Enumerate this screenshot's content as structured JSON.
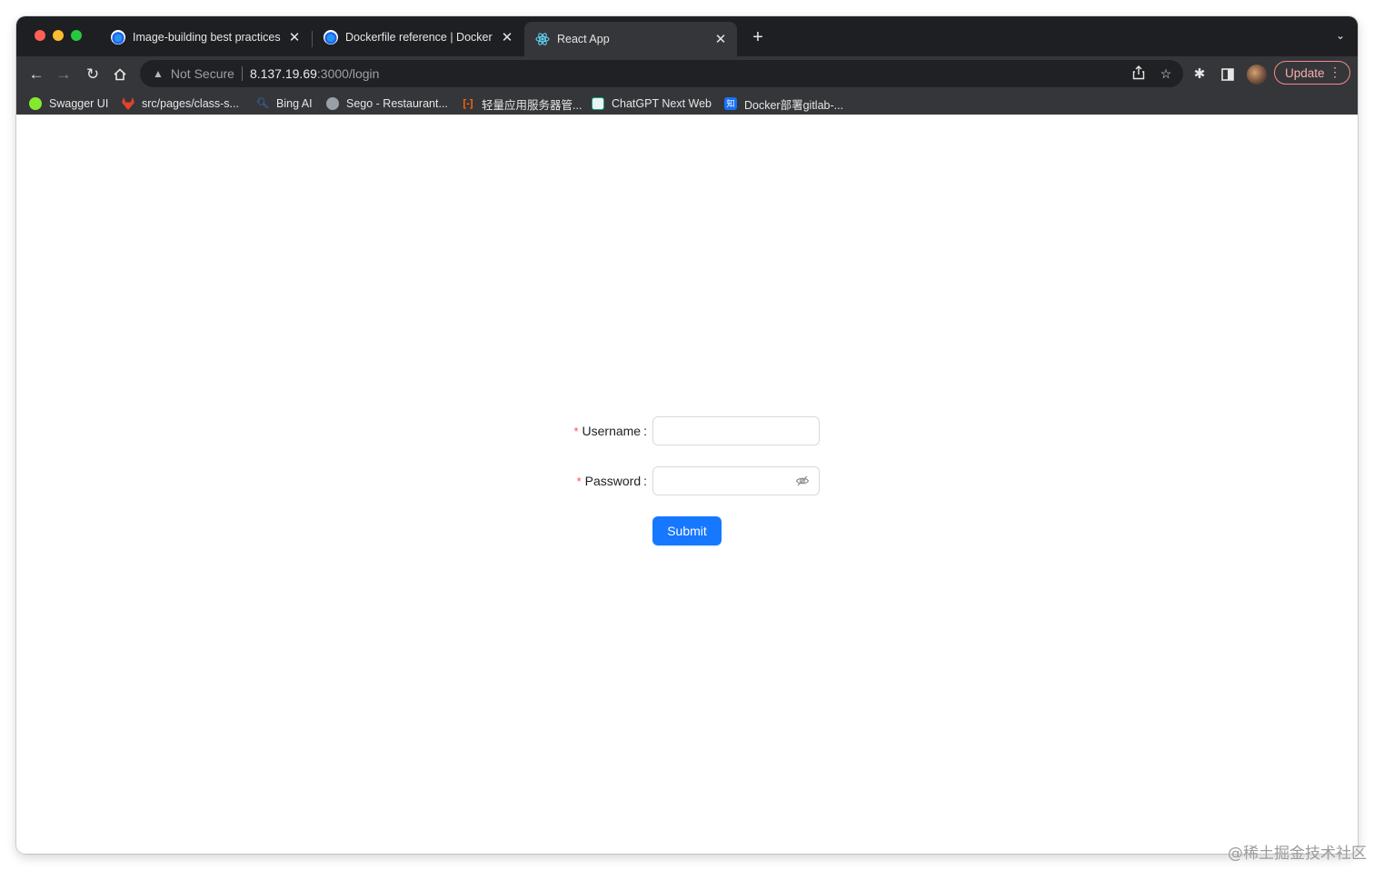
{
  "browser": {
    "tabs": [
      {
        "title": "Image-building best practices",
        "active": false
      },
      {
        "title": "Dockerfile reference | Docker D",
        "active": false
      },
      {
        "title": "React App",
        "active": true
      }
    ],
    "address": {
      "security_label": "Not Secure",
      "host": "8.137.19.69",
      "path": ":3000/login"
    },
    "update_label": "Update",
    "bookmarks": [
      {
        "label": "Swagger UI",
        "icon": "swagger-icon",
        "color": "#85ea2d"
      },
      {
        "label": "src/pages/class-s...",
        "icon": "gitlab-icon",
        "color": "#e24329"
      },
      {
        "label": "Bing AI",
        "icon": "bing-search-icon",
        "color": "#3b82f6"
      },
      {
        "label": "Sego - Restaurant...",
        "icon": "globe-icon",
        "color": "#9aa0a6"
      },
      {
        "label": "轻量应用服务器管...",
        "icon": "aliyun-icon",
        "color": "#ff6a00"
      },
      {
        "label": "ChatGPT Next Web",
        "icon": "chatgpt-icon",
        "color": "#e8f5f1"
      },
      {
        "label": "Docker部署gitlab-...",
        "icon": "zhihu-icon",
        "glyph": "知",
        "color": "#1772f6"
      }
    ]
  },
  "form": {
    "username_label": "Username",
    "password_label": "Password",
    "colon": ":",
    "required_mark": "*",
    "username_value": "",
    "password_value": "",
    "submit_label": "Submit",
    "primary_color": "#1677ff"
  },
  "watermark": "@稀土掘金技术社区"
}
